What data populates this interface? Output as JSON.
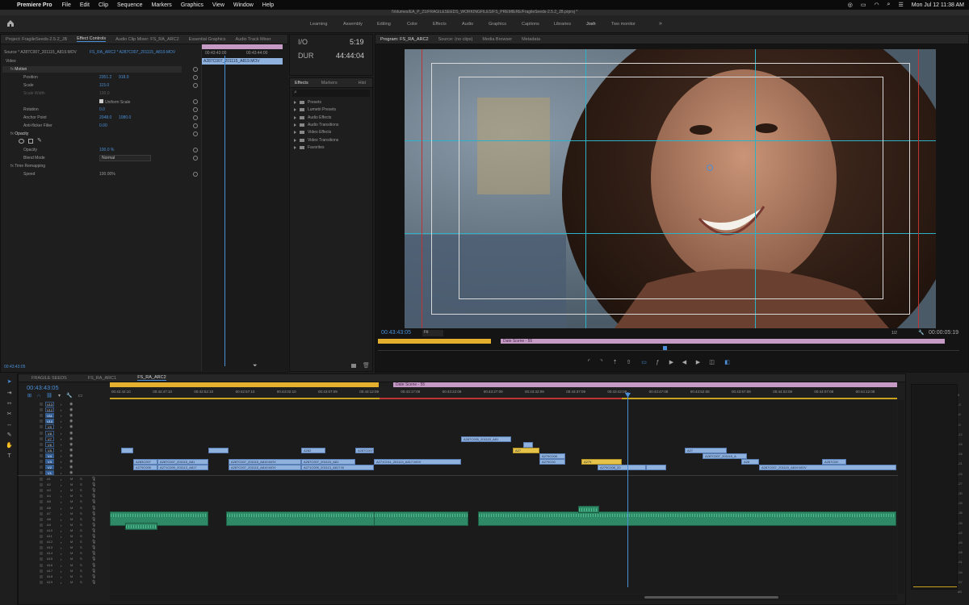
{
  "menubar": {
    "app": "Premiere Pro",
    "items": [
      "File",
      "Edit",
      "Clip",
      "Sequence",
      "Markers",
      "Graphics",
      "View",
      "Window",
      "Help"
    ],
    "clock": "Mon Jul 12  11:38 AM"
  },
  "title": "/Volumes/EA_P_21/FRAGILESEEDS_WORKINGFILES/FS_PREMIERE/FragileSeeds-2.5.2_JB.prproj *",
  "workspaces": {
    "tabs": [
      "Learning",
      "Assembly",
      "Editing",
      "Color",
      "Effects",
      "Audio",
      "Graphics",
      "Captions",
      "Libraries",
      "Josh",
      "Two monitor"
    ],
    "active": "Josh",
    "more": "»"
  },
  "source_panel": {
    "tabs": [
      "Project: FragileSeeds-2.5.2_JB",
      "Effect Controls",
      "Audio Clip Mixer: FS_RA_ARC2",
      "Essential Graphics",
      "Audio Track Mixer"
    ],
    "active_tab": "Effect Controls",
    "source_label": "Source * A287C007_201115_A819.MOV",
    "sequence_label": "FS_RA_ARC2 * A287C007_201115_A819.MOV",
    "mini_tc_1": "00:43:43:00",
    "mini_tc_2": "00:43:44:00",
    "mini_clip": "A287C007_201115_A819.MOV",
    "section_video": "Video",
    "fx_motion": "Motion",
    "position_label": "Position",
    "position_x": "2351.2",
    "position_y": "918.0",
    "scale_label": "Scale",
    "scale_value": "115.0",
    "scale_width_label": "Scale Width",
    "scale_width_value": "100.0",
    "uniform_scale": "Uniform Scale",
    "rotation_label": "Rotation",
    "rotation_value": "0.0",
    "anchor_label": "Anchor Point",
    "anchor_x": "2048.0",
    "anchor_y": "1080.0",
    "antiflicker_label": "Anti-flicker Filter",
    "antiflicker_value": "0.00",
    "fx_opacity": "Opacity",
    "opacity_label": "Opacity",
    "opacity_value": "100.0 %",
    "blend_label": "Blend Mode",
    "blend_value": "Normal",
    "fx_time": "Time Remapping",
    "speed_label": "Speed",
    "speed_value": "100.00%",
    "bottom_tc": "00:43:43:05"
  },
  "info_panel": {
    "io_label": "I/O",
    "io_value": "5:19",
    "dur_label": "DUR",
    "dur_value": "44:44:04"
  },
  "effects_panel": {
    "tabs": [
      "Effects",
      "Markers",
      "Hist"
    ],
    "items": [
      "Presets",
      "Lumetri Presets",
      "Audio Effects",
      "Audio Transitions",
      "Video Effects",
      "Video Transitions",
      "Favorites"
    ]
  },
  "program_panel": {
    "tabs": [
      "Program: FS_RA_ARC2",
      "Source: (no clips)",
      "Media Browser",
      "Metadata"
    ],
    "timecode": "00:43:43:05",
    "fit": "Fit",
    "resolution": "1/2",
    "duration": "00:00:05:19",
    "scene_label": "Date Scene - 55"
  },
  "timeline": {
    "tabs": [
      "FRAGILE SEEDS",
      "FS_RA_ARC1",
      "FS_RA_ARC2"
    ],
    "active_tab": "FS_RA_ARC2",
    "timecode": "00:43:43:05",
    "scene_label": "Date Scene - 55",
    "ruler": [
      "00:42:42:10",
      "00:42:47:10",
      "00:42:52:10",
      "00:42:57:10",
      "00:43:02:10",
      "00:43:07:09",
      "00:43:12:09",
      "00:43:17:09",
      "00:43:22:09",
      "00:43:27:09",
      "00:43:32:09",
      "00:43:37:09",
      "00:43:42:09",
      "00:43:47:08",
      "00:43:52:08",
      "00:43:57:08",
      "00:44:02:08",
      "00:44:07:08",
      "00:44:12:08"
    ],
    "video_tracks": [
      "V13",
      "V12",
      "V11",
      "V10",
      "V9",
      "V8",
      "V7",
      "V6",
      "V5",
      "V4",
      "V3",
      "V2",
      "V1"
    ],
    "audio_tracks": [
      "A1",
      "A2",
      "A3",
      "A4",
      "A5",
      "A6",
      "A7",
      "A8",
      "A9",
      "A10",
      "A11",
      "A12",
      "A13",
      "A14",
      "A15",
      "A16",
      "A17",
      "A18",
      "A19"
    ],
    "video_clips": [
      {
        "label": "A287C005_201115_A81",
        "track": 6,
        "start": 571,
        "end": 633,
        "y": false
      },
      {
        "label": "",
        "track": 7,
        "start": 648,
        "end": 660,
        "y": false
      },
      {
        "label": "A27",
        "track": 8,
        "start": 635,
        "end": 668,
        "y": true
      },
      {
        "label": "A27",
        "track": 8,
        "start": 848,
        "end": 900,
        "y": false
      },
      {
        "label": "",
        "track": 8,
        "start": 150,
        "end": 165,
        "y": false
      },
      {
        "label": "",
        "track": 8,
        "start": 258,
        "end": 283,
        "y": false
      },
      {
        "label": "A282",
        "track": 8,
        "start": 373,
        "end": 403,
        "y": false
      },
      {
        "label": "A287C007",
        "track": 8,
        "start": 440,
        "end": 463,
        "y": false
      },
      {
        "label": "A279C008",
        "track": 9,
        "start": 668,
        "end": 700,
        "y": false
      },
      {
        "label": "A287C007_201115_A",
        "track": 9,
        "start": 870,
        "end": 925,
        "y": false
      },
      {
        "label": "A283C007",
        "track": 10,
        "start": 165,
        "end": 195,
        "y": false
      },
      {
        "label": "A287C007_201115_A81",
        "track": 10,
        "start": 195,
        "end": 258,
        "y": false
      },
      {
        "label": "A287C007_201115_A819.MOV",
        "track": 10,
        "start": 283,
        "end": 373,
        "y": false
      },
      {
        "label": "A287C007_201115_A81",
        "track": 10,
        "start": 373,
        "end": 440,
        "y": false
      },
      {
        "label": "A271C011_201113_A817.MOV",
        "track": 10,
        "start": 463,
        "end": 571,
        "y": false
      },
      {
        "label": "A279C00",
        "track": 10,
        "start": 668,
        "end": 700,
        "y": false
      },
      {
        "label": "A279",
        "track": 10,
        "start": 720,
        "end": 770,
        "y": true
      },
      {
        "label": "A28",
        "track": 10,
        "start": 918,
        "end": 940,
        "y": false
      },
      {
        "label": "A287C00",
        "track": 10,
        "start": 1018,
        "end": 1048,
        "y": false
      },
      {
        "label": "A279C005",
        "track": 11,
        "start": 165,
        "end": 195,
        "y": false
      },
      {
        "label": "A271C009_201113_A817",
        "track": 11,
        "start": 195,
        "end": 258,
        "y": false
      },
      {
        "label": "A287C007_201115_A819.MOV",
        "track": 11,
        "start": 283,
        "end": 373,
        "y": false
      },
      {
        "label": "A271C009_201113_A817.M",
        "track": 11,
        "start": 373,
        "end": 463,
        "y": false
      },
      {
        "label": "A279C008_20",
        "track": 11,
        "start": 740,
        "end": 800,
        "y": false
      },
      {
        "label": "A287C007_201115_A819.MOV",
        "track": 11,
        "start": 940,
        "end": 1110,
        "y": false
      },
      {
        "label": "",
        "track": 11,
        "start": 800,
        "end": 825,
        "y": false
      }
    ],
    "audio_clips": [
      {
        "track": 6,
        "start": 136,
        "end": 258
      },
      {
        "track": 6,
        "start": 280,
        "end": 466
      },
      {
        "track": 6,
        "start": 463,
        "end": 580
      },
      {
        "track": 6,
        "start": 592,
        "end": 1110
      },
      {
        "track": 5,
        "start": 716,
        "end": 742
      },
      {
        "track": 8,
        "start": 155,
        "end": 195
      }
    ],
    "meter_scale": [
      "0",
      "-3",
      "-6",
      "-9",
      "-12",
      "-15",
      "-18",
      "-21",
      "-24",
      "-27",
      "-30",
      "-33",
      "-36",
      "-39",
      "-42",
      "-45",
      "-48",
      "-51",
      "-54",
      "-57",
      "dB"
    ]
  }
}
